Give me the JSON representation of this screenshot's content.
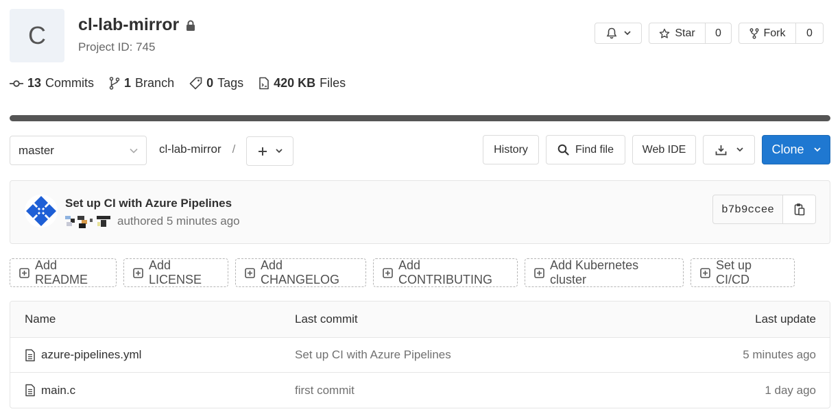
{
  "project": {
    "avatar_letter": "C",
    "name": "cl-lab-mirror",
    "id_label": "Project ID: 745"
  },
  "header_actions": {
    "star_label": "Star",
    "star_count": "0",
    "fork_label": "Fork",
    "fork_count": "0"
  },
  "stats": {
    "commits_count": "13",
    "commits_label": "Commits",
    "branch_count": "1",
    "branch_label": "Branch",
    "tags_count": "0",
    "tags_label": "Tags",
    "files_size": "420 KB",
    "files_label": "Files"
  },
  "toolbar": {
    "branch": "master",
    "breadcrumb_root": "cl-lab-mirror",
    "breadcrumb_sep": "/",
    "history_label": "History",
    "find_file_label": "Find file",
    "web_ide_label": "Web IDE",
    "clone_label": "Clone"
  },
  "last_commit": {
    "title": "Set up CI with Azure Pipelines",
    "meta": "authored 5 minutes ago",
    "sha": "b7b9ccee"
  },
  "add_buttons": [
    {
      "label": "Add README"
    },
    {
      "label": "Add LICENSE"
    },
    {
      "label": "Add CHANGELOG"
    },
    {
      "label": "Add CONTRIBUTING"
    },
    {
      "label": "Add Kubernetes cluster"
    },
    {
      "label": "Set up CI/CD"
    }
  ],
  "file_table": {
    "headers": {
      "name": "Name",
      "last_commit": "Last commit",
      "last_update": "Last update"
    },
    "rows": [
      {
        "name": "azure-pipelines.yml",
        "last_commit": "Set up CI with Azure Pipelines",
        "last_update": "5 minutes ago"
      },
      {
        "name": "main.c",
        "last_commit": "first commit",
        "last_update": "1 day ago"
      }
    ]
  },
  "colors": {
    "primary_blue": "#1f78d1",
    "progress_bar": "#555555"
  },
  "icons": {
    "lock": "lock-icon",
    "bell": "bell-icon",
    "star": "star-icon",
    "fork": "fork-icon",
    "commit": "commit-icon",
    "branch": "branch-icon",
    "tag": "tag-icon",
    "file": "file-icon",
    "search": "search-icon",
    "download": "download-icon",
    "copy": "clipboard-icon",
    "plus": "plus-icon",
    "plus_square": "plus-square-icon"
  }
}
